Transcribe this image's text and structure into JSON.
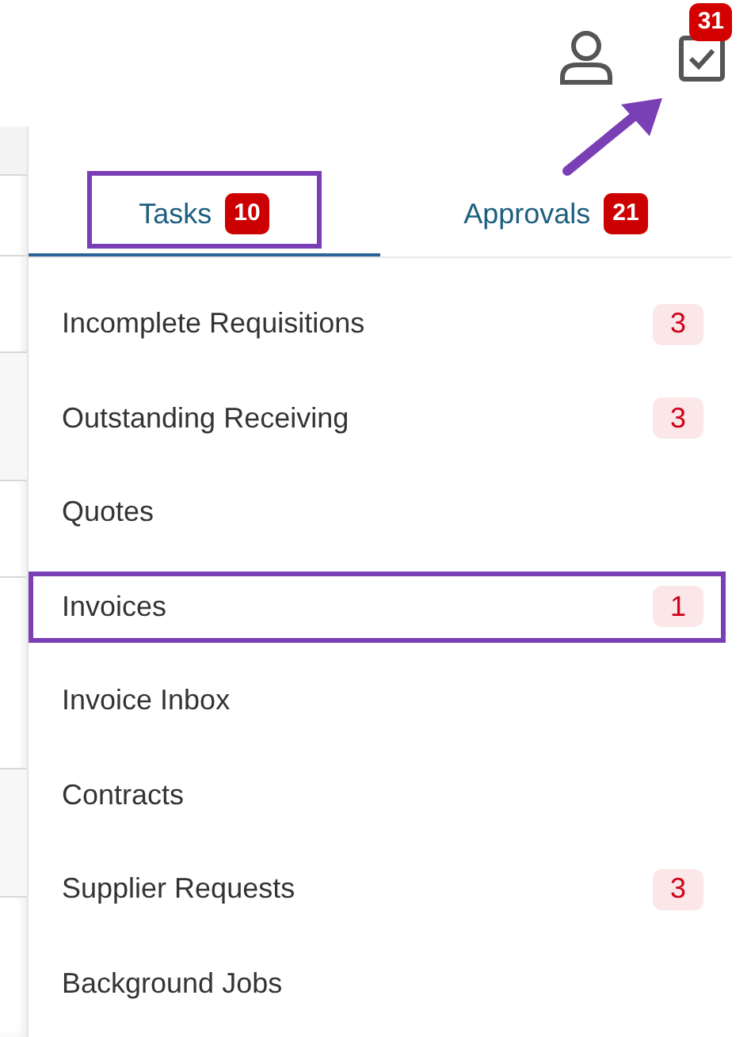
{
  "header": {
    "notification_count": "31"
  },
  "tabs": [
    {
      "label": "Tasks",
      "count": "10",
      "selected": true,
      "highlighted": true
    },
    {
      "label": "Approvals",
      "count": "21",
      "selected": false,
      "highlighted": false
    }
  ],
  "items": [
    {
      "label": "Incomplete Requisitions",
      "count": "3",
      "highlighted": false
    },
    {
      "label": "Outstanding Receiving",
      "count": "3",
      "highlighted": false
    },
    {
      "label": "Quotes",
      "highlighted": false
    },
    {
      "label": "Invoices",
      "count": "1",
      "highlighted": true
    },
    {
      "label": "Invoice Inbox",
      "highlighted": false
    },
    {
      "label": "Contracts",
      "highlighted": false
    },
    {
      "label": "Supplier Requests",
      "count": "3",
      "highlighted": false
    },
    {
      "label": "Background Jobs",
      "highlighted": false
    }
  ]
}
